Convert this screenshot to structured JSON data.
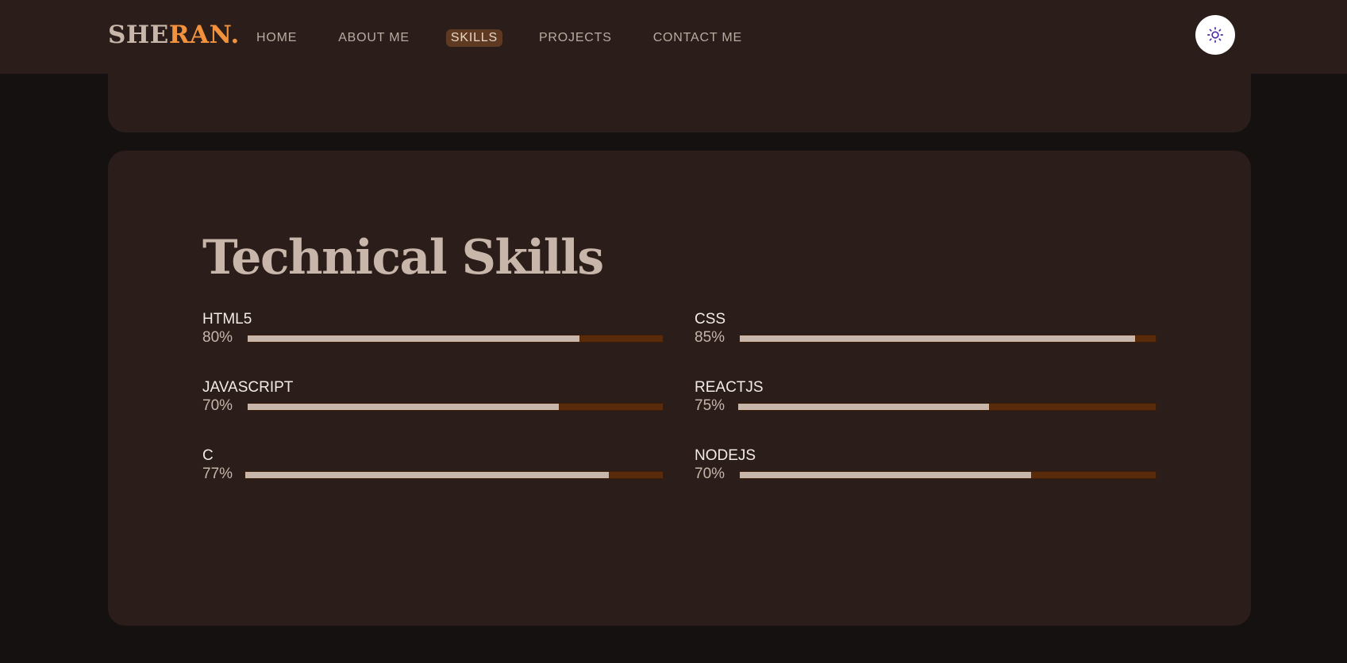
{
  "header": {
    "logo_part1": "SHE",
    "logo_part2": "RAN.",
    "nav": [
      "HOME",
      "ABOUT ME",
      "SKILLS",
      "PROJECTS",
      "CONTACT ME"
    ],
    "active_nav": "SKILLS",
    "theme_toggle_icon": "sun-icon"
  },
  "colors": {
    "background": "#161111",
    "card": "#2a1d1a",
    "accent": "#f2923c",
    "bar_fill": "#c7b6a9",
    "bar_track": "#5a2b0b",
    "nav_active_bg": "#5e3a22"
  },
  "skills_section": {
    "title": "Technical Skills",
    "skills": [
      {
        "name": "HTML5",
        "percent_label": "80%",
        "fill_fraction": 0.8
      },
      {
        "name": "CSS",
        "percent_label": "85%",
        "fill_fraction": 0.95
      },
      {
        "name": "JAVASCRIPT",
        "percent_label": "70%",
        "fill_fraction": 0.75
      },
      {
        "name": "REACTJS",
        "percent_label": "75%",
        "fill_fraction": 0.6
      },
      {
        "name": "C",
        "percent_label": "77%",
        "fill_fraction": 0.87
      },
      {
        "name": "NODEJS",
        "percent_label": "70%",
        "fill_fraction": 0.7
      }
    ]
  }
}
